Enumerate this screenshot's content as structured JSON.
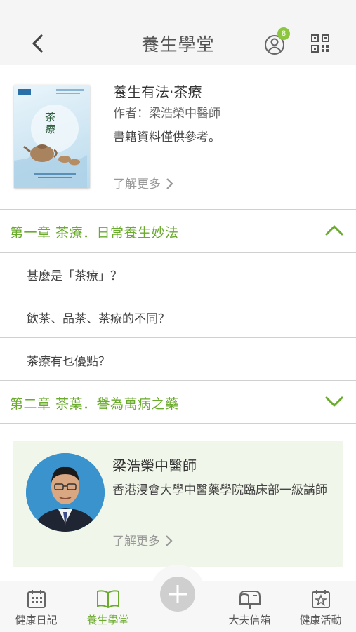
{
  "header": {
    "title": "養生學堂",
    "notification_count": "8",
    "back_icon": "chevron-left-icon",
    "user_icon": "user-icon",
    "qr_icon": "qr-code-icon"
  },
  "book": {
    "title": "養生有法·茶療",
    "author": "作者：梁浩榮中醫師",
    "note": "書籍資料僅供參考。",
    "more_label": "了解更多",
    "cover_text": "茶療"
  },
  "chapters": [
    {
      "title": "第一章 茶療．日常養生妙法",
      "expanded": true,
      "items": [
        "甚麼是「茶療」？",
        "飲茶、品茶、茶療的不同？",
        "茶療有乜優點？"
      ]
    },
    {
      "title": "第二章 茶葉．譽為萬病之藥",
      "expanded": false
    }
  ],
  "doctor": {
    "name": "梁浩榮中醫師",
    "title": "香港浸會大學中醫藥學院臨床部一級講師",
    "more_label": "了解更多"
  },
  "tabs": [
    {
      "label": "健康日記",
      "icon": "calendar-icon",
      "active": false
    },
    {
      "label": "養生學堂",
      "icon": "open-book-icon",
      "active": true
    },
    {
      "label": "大夫信箱",
      "icon": "mailbox-icon",
      "active": false
    },
    {
      "label": "健康活動",
      "icon": "event-star-icon",
      "active": false
    }
  ],
  "colors": {
    "accent": "#6aaa2c",
    "badge": "#8cc63f",
    "card_bg": "#f0f6e9"
  }
}
